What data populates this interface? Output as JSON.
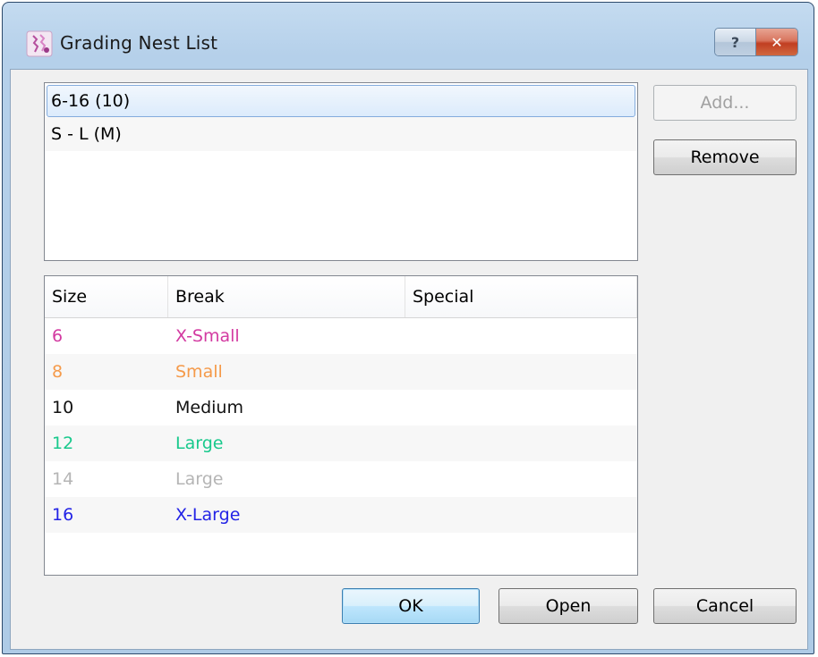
{
  "window": {
    "title": "Grading Nest List",
    "help_label": "?",
    "close_label": "✕",
    "app_icon": "grading-app-icon"
  },
  "nest_list": [
    {
      "label": "6-16 (10)",
      "selected": true
    },
    {
      "label": "S - L (M)",
      "selected": false
    }
  ],
  "side_buttons": {
    "add_label": "Add...",
    "remove_label": "Remove"
  },
  "size_table": {
    "columns": [
      "Size",
      "Break",
      "Special"
    ],
    "rows": [
      {
        "size": "6",
        "break": "X-Small",
        "special": "",
        "color": "#d33aa1"
      },
      {
        "size": "8",
        "break": "Small",
        "special": "",
        "color": "#f59a4a"
      },
      {
        "size": "10",
        "break": "Medium",
        "special": "",
        "color": "#111111"
      },
      {
        "size": "12",
        "break": "Large",
        "special": "",
        "color": "#18c98c"
      },
      {
        "size": "14",
        "break": "Large",
        "special": "",
        "color": "#b5b5b5"
      },
      {
        "size": "16",
        "break": "X-Large",
        "special": "",
        "color": "#2323e6"
      }
    ]
  },
  "footer_buttons": {
    "ok_label": "OK",
    "open_label": "Open",
    "cancel_label": "Cancel"
  }
}
